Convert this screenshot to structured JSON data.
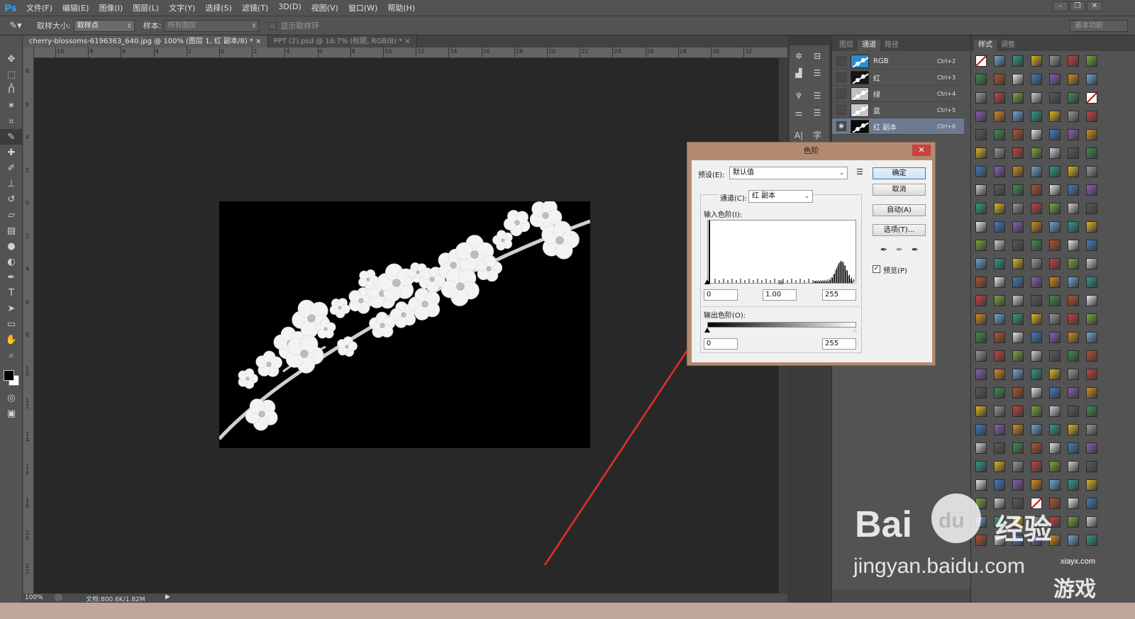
{
  "app": {
    "logo": "Ps"
  },
  "menu": [
    "文件(F)",
    "编辑(E)",
    "图像(I)",
    "图层(L)",
    "文字(Y)",
    "选择(S)",
    "滤镜(T)",
    "3D(D)",
    "视图(V)",
    "窗口(W)",
    "帮助(H)"
  ],
  "window_controls": [
    "–",
    "❐",
    "✕"
  ],
  "options": {
    "sample_size_label": "取样大小:",
    "sample_size_value": "取样点",
    "sample_label": "样本:",
    "sample_value": "所有图层",
    "show_ring_label": "显示取样环",
    "workspace": "基本功能"
  },
  "tabs": [
    {
      "label": "cherry-blossoms-6196363_640.jpg @ 100% (图层 1, 红 副本/8) *",
      "close": "×",
      "active": true
    },
    {
      "label": "PPT (2).psd @ 16.7% (标题, RGB/8) *",
      "close": "×",
      "active": false
    }
  ],
  "ruler": {
    "h_labels": [
      "10",
      "8",
      "6",
      "4",
      "2",
      "0",
      "2",
      "4",
      "6",
      "8",
      "10",
      "12",
      "14",
      "16",
      "18",
      "20",
      "22",
      "24",
      "26",
      "28",
      "30",
      "32"
    ],
    "v_labels": [
      "8",
      "6",
      "4",
      "2",
      "0",
      "2",
      "4",
      "6",
      "8",
      "1\n0",
      "1\n2",
      "1\n4",
      "1\n6",
      "1\n8",
      "2\n0",
      "2\n2"
    ]
  },
  "status": {
    "zoom": "100%",
    "doc": "文档:800.6K/1.82M"
  },
  "channels_panel": {
    "tabs": [
      "图层",
      "通道",
      "路径"
    ],
    "active_tab": 1,
    "channels": [
      {
        "name": "RGB",
        "shortcut": "Ctrl+2",
        "visible": false
      },
      {
        "name": "红",
        "shortcut": "Ctrl+3",
        "visible": false
      },
      {
        "name": "绿",
        "shortcut": "Ctrl+4",
        "visible": false
      },
      {
        "name": "蓝",
        "shortcut": "Ctrl+5",
        "visible": false
      },
      {
        "name": "红 副本",
        "shortcut": "Ctrl+6",
        "visible": true
      }
    ]
  },
  "styles_panel": {
    "tabs": [
      "样式",
      "调整"
    ]
  },
  "levels_dialog": {
    "title": "色阶",
    "close": "✕",
    "preset_label": "预设(E):",
    "preset_value": "默认值",
    "channel_label": "通道(C):",
    "channel_value": "红 副本",
    "input_label": "输入色阶(I):",
    "input_black": "0",
    "input_gamma": "1.00",
    "input_white": "255",
    "output_label": "输出色阶(O):",
    "output_black": "0",
    "output_white": "255",
    "buttons": {
      "ok": "确定",
      "cancel": "取消",
      "auto": "自动(A)",
      "options": "选项(T)..."
    },
    "preview_label": "预览(P)",
    "preview_checked": true
  },
  "watermark": {
    "brand": "Bai",
    "brand2": "du",
    "brand_cn": "经验",
    "url": "jingyan.baidu.com",
    "site2": "xiayx.com",
    "site2_cn": "游戏"
  }
}
